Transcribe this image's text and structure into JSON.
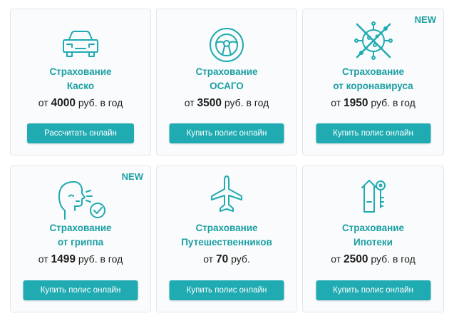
{
  "colors": {
    "accent": "#1fabb1",
    "title": "#1a9fa3",
    "card_bg": "#fafbfc"
  },
  "cards": [
    {
      "icon": "car-icon",
      "badge": "",
      "title_line1": "Страхование",
      "title_line2": "Каско",
      "price_prefix": "от",
      "price_value": "4000",
      "price_suffix": "руб. в год",
      "button": "Рассчитать онлайн"
    },
    {
      "icon": "steering-wheel-icon",
      "badge": "",
      "title_line1": "Страхование",
      "title_line2": "ОСАГО",
      "price_prefix": "от",
      "price_value": "3500",
      "price_suffix": "руб. в год",
      "button": "Купить полис онлайн"
    },
    {
      "icon": "virus-crossed-icon",
      "badge": "NEW",
      "title_line1": "Страхование",
      "title_line2": "от коронавируса",
      "price_prefix": "от",
      "price_value": "1950",
      "price_suffix": "руб. в год",
      "button": "Купить полис онлайн"
    },
    {
      "icon": "sneezing-person-check-icon",
      "badge": "NEW",
      "title_line1": "Страхование",
      "title_line2": "от гриппа",
      "price_prefix": "от",
      "price_value": "1499",
      "price_suffix": "руб. в год",
      "button": "Купить полис онлайн"
    },
    {
      "icon": "airplane-icon",
      "badge": "",
      "title_line1": "Страхование",
      "title_line2": "Путешественников",
      "price_prefix": "от",
      "price_value": "70",
      "price_suffix": "руб.",
      "button": "Купить полис онлайн"
    },
    {
      "icon": "house-key-icon",
      "badge": "",
      "title_line1": "Страхование",
      "title_line2": "Ипотеки",
      "price_prefix": "от",
      "price_value": "2500",
      "price_suffix": "руб. в год",
      "button": "Купить полис онлайн"
    }
  ]
}
